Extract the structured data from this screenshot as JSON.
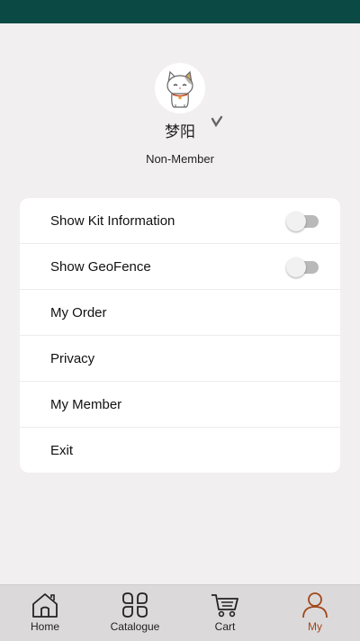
{
  "profile": {
    "username": "梦阳",
    "membership": "Non-Member"
  },
  "menu": {
    "items": [
      {
        "label": "Show Kit Information",
        "toggle": false
      },
      {
        "label": "Show GeoFence",
        "toggle": false
      },
      {
        "label": "My Order"
      },
      {
        "label": "Privacy"
      },
      {
        "label": "My Member"
      },
      {
        "label": "Exit"
      }
    ]
  },
  "tabs": [
    {
      "label": "Home",
      "icon": "home-icon"
    },
    {
      "label": "Catalogue",
      "icon": "catalogue-icon"
    },
    {
      "label": "Cart",
      "icon": "cart-icon"
    },
    {
      "label": "My",
      "icon": "user-icon",
      "active": true
    }
  ],
  "colors": {
    "status_bar": "#0b4a44",
    "accent": "#a0481b",
    "background": "#f2eff0"
  }
}
